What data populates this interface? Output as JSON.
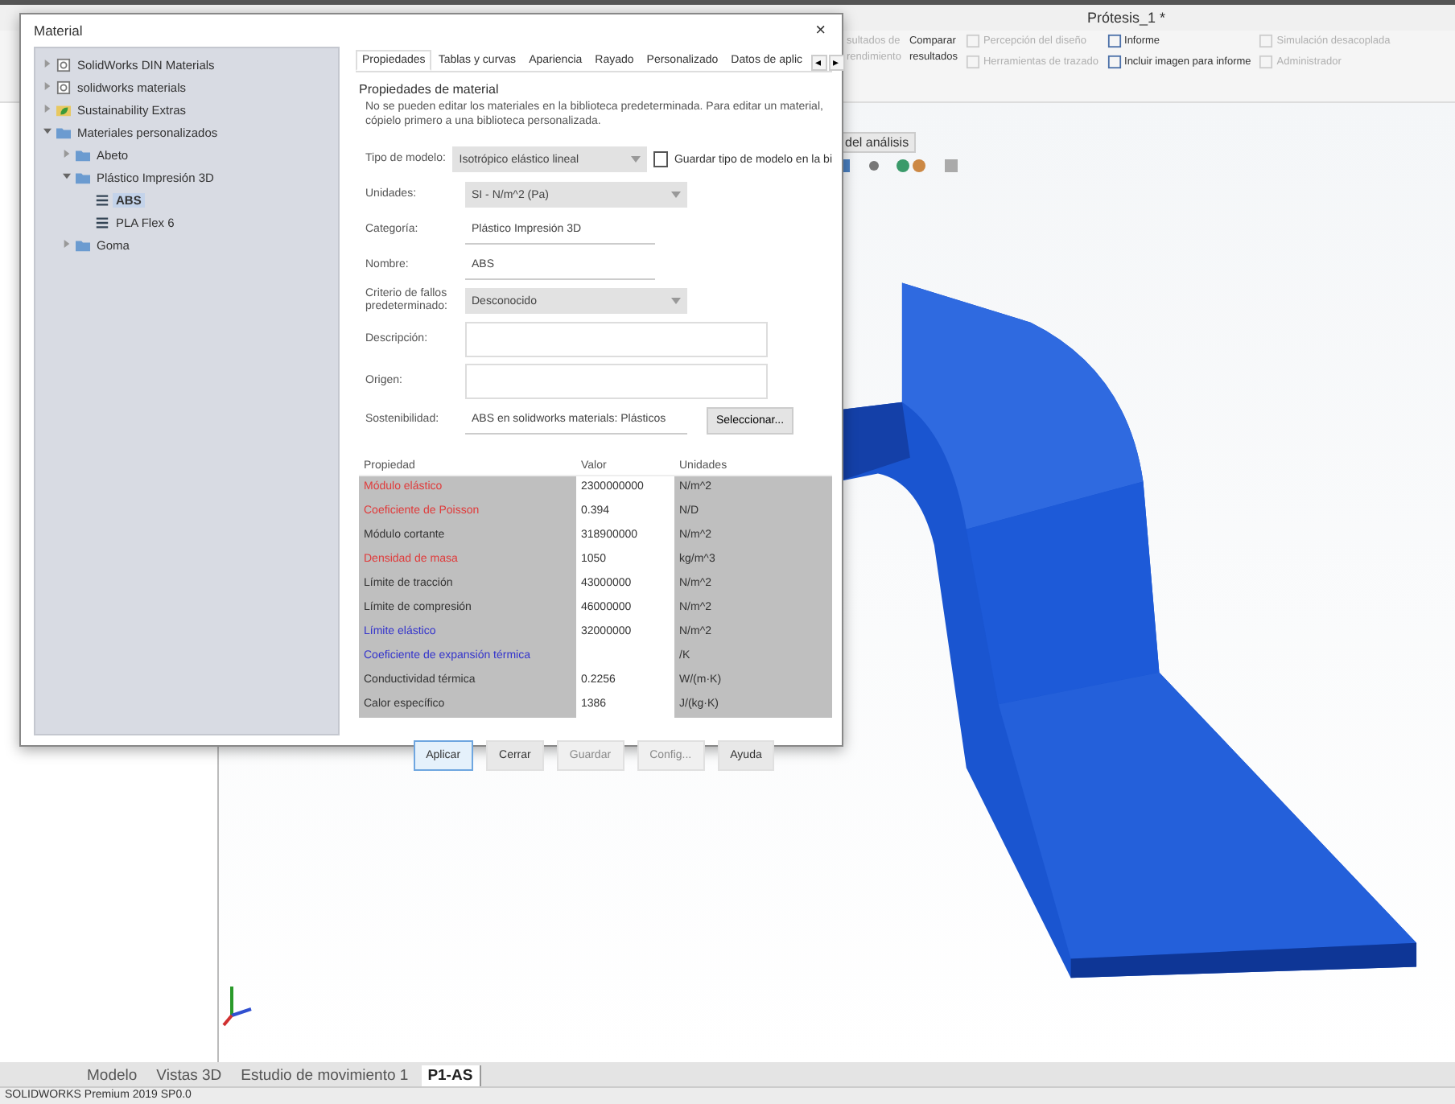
{
  "app": {
    "title": "Prótesis_1 *"
  },
  "ribbon": {
    "items": [
      {
        "kind": "large",
        "lines": [
          "sultados de",
          "rendimiento"
        ],
        "disabled": true
      },
      {
        "kind": "large",
        "lines": [
          "Comparar",
          "resultados"
        ],
        "disabled": false
      },
      {
        "kind": "small",
        "lines": [
          "Percepción del diseño"
        ],
        "disabled": true
      },
      {
        "kind": "small",
        "lines": [
          "Herramientas de trazado"
        ],
        "disabled": true
      },
      {
        "kind": "small",
        "lines": [
          "Informe"
        ],
        "disabled": false
      },
      {
        "kind": "small",
        "lines": [
          "Incluir imagen para informe"
        ],
        "disabled": false
      },
      {
        "kind": "small",
        "lines": [
          "Simulación desacoplada"
        ],
        "disabled": true
      },
      {
        "kind": "small",
        "lines": [
          "Administrador"
        ],
        "disabled": true
      }
    ]
  },
  "analysis_tab": "del análisis",
  "dialog": {
    "title": "Material",
    "close": "×",
    "tree": [
      {
        "label": "SolidWorks DIN Materials",
        "expanded": false,
        "selected": false,
        "kind": "library"
      },
      {
        "label": "solidworks materials",
        "expanded": false,
        "selected": false,
        "kind": "library"
      },
      {
        "label": "Sustainability Extras",
        "expanded": false,
        "selected": false,
        "kind": "green"
      },
      {
        "label": "Materiales personalizados",
        "expanded": true,
        "selected": false,
        "kind": "folder",
        "children": [
          {
            "label": "Abeto",
            "expanded": false,
            "selected": false,
            "kind": "folder"
          },
          {
            "label": "Plástico Impresión 3D",
            "expanded": true,
            "selected": false,
            "kind": "folder",
            "children": [
              {
                "label": "ABS",
                "selected": true,
                "kind": "material"
              },
              {
                "label": "PLA Flex 6",
                "selected": false,
                "kind": "material"
              }
            ]
          },
          {
            "label": "Goma",
            "expanded": false,
            "selected": false,
            "kind": "folder"
          }
        ]
      }
    ],
    "tabs": [
      {
        "label": "Propiedades",
        "selected": true
      },
      {
        "label": "Tablas y curvas",
        "selected": false
      },
      {
        "label": "Apariencia",
        "selected": false
      },
      {
        "label": "Rayado",
        "selected": false
      },
      {
        "label": "Personalizado",
        "selected": false
      },
      {
        "label": "Datos de aplic",
        "selected": false
      }
    ],
    "tab_scroll": [
      "◂",
      "▸"
    ],
    "group_title": "Propiedades de material",
    "note": "No se pueden editar los materiales en la biblioteca predeterminada. Para editar un material, cópielo primero a una biblioteca personalizada.",
    "fields": [
      {
        "kind": "dropdown",
        "label": "Tipo de modelo:",
        "value": "Isotrópico elástico lineal",
        "checkbox": {
          "label": "Guardar tipo de modelo en la bi",
          "checked": false
        }
      },
      {
        "kind": "dropdown",
        "label": "Unidades:",
        "value": "SI - N/m^2 (Pa)"
      },
      {
        "kind": "text",
        "label": "Categoría:",
        "value": "Plástico Impresión 3D"
      },
      {
        "kind": "text",
        "label": "Nombre:",
        "value": "ABS"
      },
      {
        "kind": "dropdown",
        "label": "Criterio de fallos predeterminado:",
        "value": "Desconocido"
      },
      {
        "kind": "wide",
        "label": "Descripción:"
      },
      {
        "kind": "wide",
        "label": "Origen:"
      },
      {
        "kind": "text",
        "label": "Sostenibilidad:",
        "value": "ABS en solidworks materials: Plásticos",
        "button": "Seleccionar..."
      }
    ],
    "table": {
      "columns": [
        "Propiedad",
        "Valor",
        "Unidades"
      ],
      "rows": [
        {
          "property": "Módulo elástico",
          "value": "2300000000",
          "unit": "N/m^2",
          "color": "#e03a3a"
        },
        {
          "property": "Coeficiente de Poisson",
          "value": "0.394",
          "unit": "N/D",
          "color": "#e03a3a"
        },
        {
          "property": "Módulo cortante",
          "value": "318900000",
          "unit": "N/m^2",
          "color": "#333333"
        },
        {
          "property": "Densidad de masa",
          "value": "1050",
          "unit": "kg/m^3",
          "color": "#e03a3a"
        },
        {
          "property": "Límite de tracción",
          "value": "43000000",
          "unit": "N/m^2",
          "color": "#333333"
        },
        {
          "property": "Límite de compresión",
          "value": "46000000",
          "unit": "N/m^2",
          "color": "#333333"
        },
        {
          "property": "Límite elástico",
          "value": "32000000",
          "unit": "N/m^2",
          "color": "#3333cc"
        },
        {
          "property": "Coeficiente de expansión térmica",
          "unit": "/K",
          "color": "#3333cc"
        },
        {
          "property": "Conductividad térmica",
          "value": "0.2256",
          "unit": "W/(m·K)",
          "color": "#333333"
        },
        {
          "property": "Calor específico",
          "value": "1386",
          "unit": "J/(kg·K)",
          "color": "#333333"
        }
      ]
    },
    "buttons": [
      {
        "label": "Aplicar",
        "disabled": false,
        "selected": true
      },
      {
        "label": "Cerrar",
        "disabled": false,
        "selected": false
      },
      {
        "label": "Guardar",
        "disabled": true,
        "selected": false
      },
      {
        "label": "Config...",
        "disabled": true,
        "selected": false
      },
      {
        "label": "Ayuda",
        "disabled": false,
        "selected": false
      }
    ]
  },
  "bottom_tabs": [
    {
      "label": "Modelo",
      "selected": false
    },
    {
      "label": "Vistas 3D",
      "selected": false
    },
    {
      "label": "Estudio de movimiento 1",
      "selected": false
    },
    {
      "label": "P1-AS",
      "selected": true
    }
  ],
  "status_bar": "SOLIDWORKS Premium 2019 SP0.0"
}
